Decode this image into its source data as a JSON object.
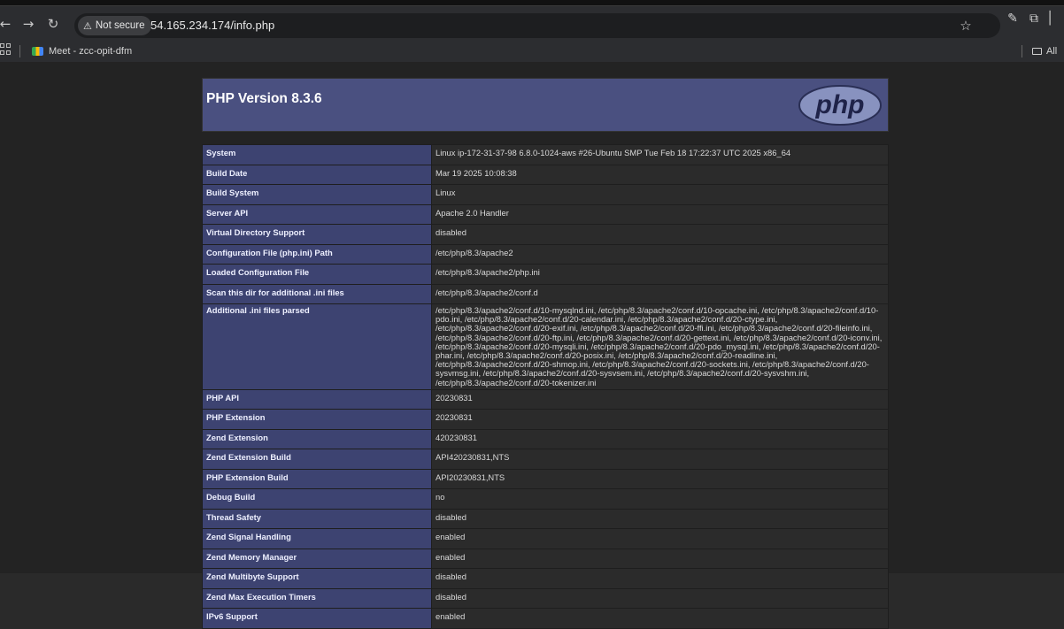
{
  "browser": {
    "security_label": "Not secure",
    "url": "54.165.234.174/info.php",
    "bookmark_label": "Meet - zcc-opit-dfm",
    "bookmark_folder_label": "All"
  },
  "header": {
    "title": "PHP Version 8.3.6",
    "logo_text": "php"
  },
  "rows": [
    {
      "key": "System",
      "value": "Linux ip-172-31-37-98 6.8.0-1024-aws #26-Ubuntu SMP Tue Feb 18 17:22:37 UTC 2025 x86_64"
    },
    {
      "key": "Build Date",
      "value": "Mar 19 2025 10:08:38"
    },
    {
      "key": "Build System",
      "value": "Linux"
    },
    {
      "key": "Server API",
      "value": "Apache 2.0 Handler"
    },
    {
      "key": "Virtual Directory Support",
      "value": "disabled"
    },
    {
      "key": "Configuration File (php.ini) Path",
      "value": "/etc/php/8.3/apache2"
    },
    {
      "key": "Loaded Configuration File",
      "value": "/etc/php/8.3/apache2/php.ini"
    },
    {
      "key": "Scan this dir for additional .ini files",
      "value": "/etc/php/8.3/apache2/conf.d"
    },
    {
      "key": "Additional .ini files parsed",
      "value": "/etc/php/8.3/apache2/conf.d/10-mysqlnd.ini, /etc/php/8.3/apache2/conf.d/10-opcache.ini, /etc/php/8.3/apache2/conf.d/10-pdo.ini, /etc/php/8.3/apache2/conf.d/20-calendar.ini, /etc/php/8.3/apache2/conf.d/20-ctype.ini, /etc/php/8.3/apache2/conf.d/20-exif.ini, /etc/php/8.3/apache2/conf.d/20-ffi.ini, /etc/php/8.3/apache2/conf.d/20-fileinfo.ini, /etc/php/8.3/apache2/conf.d/20-ftp.ini, /etc/php/8.3/apache2/conf.d/20-gettext.ini, /etc/php/8.3/apache2/conf.d/20-iconv.ini, /etc/php/8.3/apache2/conf.d/20-mysqli.ini, /etc/php/8.3/apache2/conf.d/20-pdo_mysql.ini, /etc/php/8.3/apache2/conf.d/20-phar.ini, /etc/php/8.3/apache2/conf.d/20-posix.ini, /etc/php/8.3/apache2/conf.d/20-readline.ini, /etc/php/8.3/apache2/conf.d/20-shmop.ini, /etc/php/8.3/apache2/conf.d/20-sockets.ini, /etc/php/8.3/apache2/conf.d/20-sysvmsg.ini, /etc/php/8.3/apache2/conf.d/20-sysvsem.ini, /etc/php/8.3/apache2/conf.d/20-sysvshm.ini, /etc/php/8.3/apache2/conf.d/20-tokenizer.ini"
    },
    {
      "key": "PHP API",
      "value": "20230831"
    },
    {
      "key": "PHP Extension",
      "value": "20230831"
    },
    {
      "key": "Zend Extension",
      "value": "420230831"
    },
    {
      "key": "Zend Extension Build",
      "value": "API420230831,NTS"
    },
    {
      "key": "PHP Extension Build",
      "value": "API20230831,NTS"
    },
    {
      "key": "Debug Build",
      "value": "no"
    },
    {
      "key": "Thread Safety",
      "value": "disabled"
    },
    {
      "key": "Zend Signal Handling",
      "value": "enabled"
    },
    {
      "key": "Zend Memory Manager",
      "value": "enabled"
    },
    {
      "key": "Zend Multibyte Support",
      "value": "disabled"
    },
    {
      "key": "Zend Max Execution Timers",
      "value": "disabled"
    },
    {
      "key": "IPv6 Support",
      "value": "enabled"
    }
  ],
  "colors": {
    "header_bg": "#4a5080",
    "key_bg": "#3d4371",
    "value_bg": "#2b2b2b",
    "page_bg": "#232323"
  },
  "icons": [
    "back-arrow-icon",
    "forward-arrow-icon",
    "reload-icon",
    "warning-icon",
    "star-icon",
    "extension-icon",
    "puzzle-icon",
    "apps-grid-icon",
    "meet-icon",
    "folder-icon"
  ]
}
